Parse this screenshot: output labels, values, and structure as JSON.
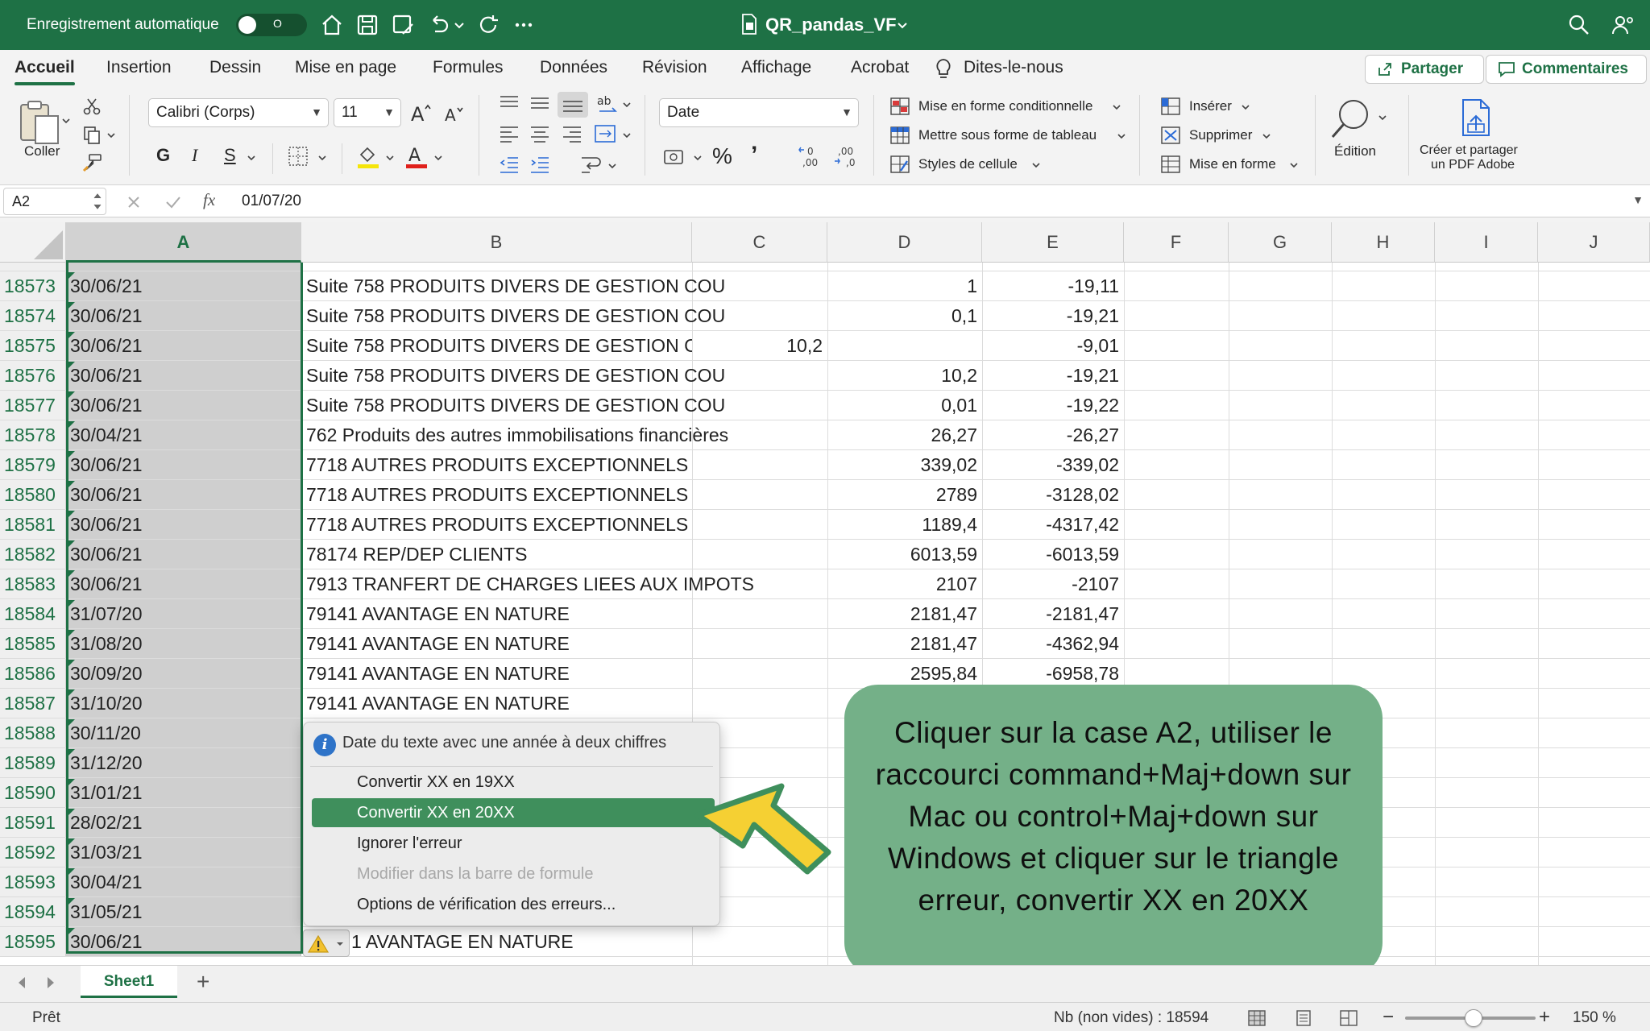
{
  "titlebar": {
    "autosave_label": "Enregistrement automatique",
    "toggle_state": "O",
    "doc_title": "QR_pandas_VF"
  },
  "ribbon_tabs": [
    "Accueil",
    "Insertion",
    "Dessin",
    "Mise en page",
    "Formules",
    "Données",
    "Révision",
    "Affichage",
    "Acrobat",
    "Dites-le-nous"
  ],
  "share_button": "Partager",
  "comments_button": "Commentaires",
  "ribbon": {
    "paste_label": "Coller",
    "font_name": "Calibri (Corps)",
    "font_size": "11",
    "number_format": "Date",
    "cond_format": "Mise en forme conditionnelle",
    "table_format": "Mettre sous forme de tableau",
    "cell_styles": "Styles de cellule",
    "insert": "Insérer",
    "delete": "Supprimer",
    "format": "Mise en forme",
    "editing": "Édition",
    "pdf_line1": "Créer et partager",
    "pdf_line2": "un PDF Adobe"
  },
  "formula_bar": {
    "name_box": "A2",
    "fx": "fx",
    "value": "01/07/20"
  },
  "columns": [
    "A",
    "B",
    "C",
    "D",
    "E",
    "F",
    "G",
    "H",
    "I",
    "J"
  ],
  "rows": [
    {
      "n": "18573",
      "a": "30/06/21",
      "b": "Suite 758  PRODUITS DIVERS DE GESTION COU",
      "c": "",
      "d": "1",
      "e": "-19,11"
    },
    {
      "n": "18574",
      "a": "30/06/21",
      "b": "Suite 758  PRODUITS DIVERS DE GESTION COU",
      "c": "",
      "d": "0,1",
      "e": "-19,21"
    },
    {
      "n": "18575",
      "a": "30/06/21",
      "b": "Suite 758  PRODUITS DIVERS DE GESTION C",
      "c": "10,2",
      "d": "",
      "e": "-9,01"
    },
    {
      "n": "18576",
      "a": "30/06/21",
      "b": "Suite 758  PRODUITS DIVERS DE GESTION COU",
      "c": "",
      "d": "10,2",
      "e": "-19,21"
    },
    {
      "n": "18577",
      "a": "30/06/21",
      "b": "Suite 758  PRODUITS DIVERS DE GESTION COU",
      "c": "",
      "d": "0,01",
      "e": "-19,22"
    },
    {
      "n": "18578",
      "a": "30/04/21",
      "b": "762  Produits des autres immobilisations financières",
      "c": "",
      "d": "26,27",
      "e": "-26,27"
    },
    {
      "n": "18579",
      "a": "30/06/21",
      "b": "7718  AUTRES PRODUITS EXCEPTIONNELS",
      "c": "",
      "d": "339,02",
      "e": "-339,02"
    },
    {
      "n": "18580",
      "a": "30/06/21",
      "b": "7718  AUTRES PRODUITS EXCEPTIONNELS",
      "c": "",
      "d": "2789",
      "e": "-3128,02"
    },
    {
      "n": "18581",
      "a": "30/06/21",
      "b": "7718  AUTRES PRODUITS EXCEPTIONNELS",
      "c": "",
      "d": "1189,4",
      "e": "-4317,42"
    },
    {
      "n": "18582",
      "a": "30/06/21",
      "b": "78174  REP/DEP CLIENTS",
      "c": "",
      "d": "6013,59",
      "e": "-6013,59"
    },
    {
      "n": "18583",
      "a": "30/06/21",
      "b": "7913  TRANFERT DE CHARGES LIEES AUX IMPOTS",
      "c": "",
      "d": "2107",
      "e": "-2107"
    },
    {
      "n": "18584",
      "a": "31/07/20",
      "b": "79141  AVANTAGE EN NATURE",
      "c": "",
      "d": "2181,47",
      "e": "-2181,47"
    },
    {
      "n": "18585",
      "a": "31/08/20",
      "b": "79141  AVANTAGE EN NATURE",
      "c": "",
      "d": "2181,47",
      "e": "-4362,94"
    },
    {
      "n": "18586",
      "a": "30/09/20",
      "b": "79141  AVANTAGE EN NATURE",
      "c": "",
      "d": "2595,84",
      "e": "-6958,78"
    },
    {
      "n": "18587",
      "a": "31/10/20",
      "b": "79141  AVANTAGE EN NATURE",
      "c": "",
      "d": "",
      "e": ""
    },
    {
      "n": "18588",
      "a": "30/11/20",
      "b": "",
      "c": "",
      "d": "",
      "e": ""
    },
    {
      "n": "18589",
      "a": "31/12/20",
      "b": "",
      "c": "",
      "d": "",
      "e": ""
    },
    {
      "n": "18590",
      "a": "31/01/21",
      "b": "",
      "c": "",
      "d": "",
      "e": ""
    },
    {
      "n": "18591",
      "a": "28/02/21",
      "b": "",
      "c": "",
      "d": "",
      "e": ""
    },
    {
      "n": "18592",
      "a": "31/03/21",
      "b": "",
      "c": "",
      "d": "",
      "e": ""
    },
    {
      "n": "18593",
      "a": "30/04/21",
      "b": "",
      "c": "",
      "d": "",
      "e": ""
    },
    {
      "n": "18594",
      "a": "31/05/21",
      "b": "",
      "c": "",
      "d": "",
      "e": ""
    },
    {
      "n": "18595",
      "a": "30/06/21",
      "b": "1  AVANTAGE EN NATURE",
      "c": "",
      "d": "",
      "e": ""
    }
  ],
  "error_menu": {
    "header": "Date du texte avec une année à deux chiffres",
    "items": [
      {
        "label": "Convertir XX en 19XX",
        "state": "normal"
      },
      {
        "label": "Convertir  XX en 20XX",
        "state": "highlighted"
      },
      {
        "label": "Ignorer l'erreur",
        "state": "normal"
      },
      {
        "label": "Modifier dans la barre de formule",
        "state": "disabled"
      },
      {
        "label": "Options de vérification des erreurs...",
        "state": "normal"
      }
    ]
  },
  "callout": {
    "text": "Cliquer sur la case A2, utiliser le raccourci command+Maj+down sur Mac ou control+Maj+down sur Windows et cliquer sur le triangle erreur, convertir XX en 20XX"
  },
  "sheet_tabs": [
    "Sheet1"
  ],
  "add_sheet": "+",
  "status": {
    "ready": "Prêt",
    "count": "Nb (non vides) : 18594",
    "zoom": "150 %"
  },
  "colors": {
    "excel_green": "#1e7145",
    "callout_bg": "#74b088",
    "arrow_yellow": "#f5d033",
    "menu_highlight": "#3f8f5c"
  }
}
